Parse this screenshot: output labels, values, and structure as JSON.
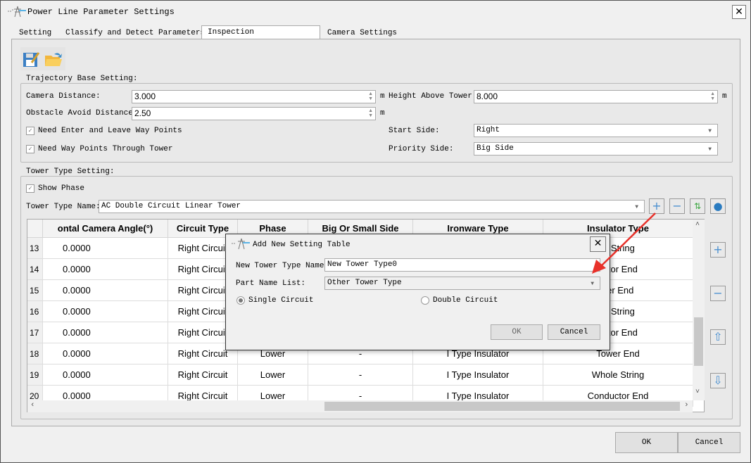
{
  "window": {
    "title": "Power Line Parameter Settings",
    "close": "✕"
  },
  "tabs": [
    {
      "label": "Setting"
    },
    {
      "label": "Classify and Detect Parameters"
    },
    {
      "label": "Inspection Configuration",
      "active": true
    },
    {
      "label": "Camera Settings"
    }
  ],
  "trajectory": {
    "title": "Trajectory Base Setting:",
    "camera_distance_label": "Camera Distance:",
    "camera_distance": "3.000",
    "unit": "m",
    "height_above_label": "Height Above Tower:",
    "height_above": "8.000",
    "obstacle_label": "Obstacle Avoid Distance:",
    "obstacle": "2.50",
    "enter_leave_label": "Need Enter and Leave Way Points",
    "enter_leave_checked": true,
    "through_tower_label": "Need Way Points Through Tower",
    "through_tower_checked": true,
    "start_side_label": "Start Side:",
    "start_side": "Right",
    "priority_side_label": "Priority Side:",
    "priority_side": "Big Side"
  },
  "tower": {
    "title": "Tower Type Setting:",
    "show_phase_label": "Show Phase",
    "show_phase_checked": true,
    "name_label": "Tower Type Name:",
    "name": "AC Double Circuit Linear Tower"
  },
  "table": {
    "columns": [
      "ontal Camera Angle(°)",
      "Circuit Type",
      "Phase",
      "Big Or Small Side",
      "Ironware Type",
      "Insulator Type"
    ],
    "rows": [
      [
        "13",
        "0.0000",
        "Right Circuit",
        "",
        "",
        "",
        "le String"
      ],
      [
        "14",
        "0.0000",
        "Right Circuit",
        "",
        "",
        "",
        "uctor End"
      ],
      [
        "15",
        "0.0000",
        "Right Circuit",
        "",
        "",
        "",
        "ver End"
      ],
      [
        "16",
        "0.0000",
        "Right Circuit",
        "",
        "",
        "",
        "le String"
      ],
      [
        "17",
        "0.0000",
        "Right Circuit",
        "",
        "",
        "",
        "uctor End"
      ],
      [
        "18",
        "0.0000",
        "Right Circuit",
        "Lower",
        "-",
        "I Type Insulator",
        "Tower End"
      ],
      [
        "19",
        "0.0000",
        "Right Circuit",
        "Lower",
        "-",
        "I Type Insulator",
        "Whole String"
      ],
      [
        "20",
        "0.0000",
        "Right Circuit",
        "Lower",
        "-",
        "I Type Insulator",
        "Conductor End"
      ]
    ]
  },
  "footer": {
    "ok": "OK",
    "cancel": "Cancel"
  },
  "dialog": {
    "title": "Add New Setting Table",
    "close": "✕",
    "name_label": "New Tower Type Name:",
    "name": "New Tower Type0",
    "part_label": "Part Name List:",
    "part": "Other Tower Type",
    "single": "Single Circuit",
    "double": "Double Circuit",
    "selected": "single",
    "ok": "OK",
    "cancel": "Cancel"
  },
  "annotation": {
    "color": "#e8312a"
  }
}
